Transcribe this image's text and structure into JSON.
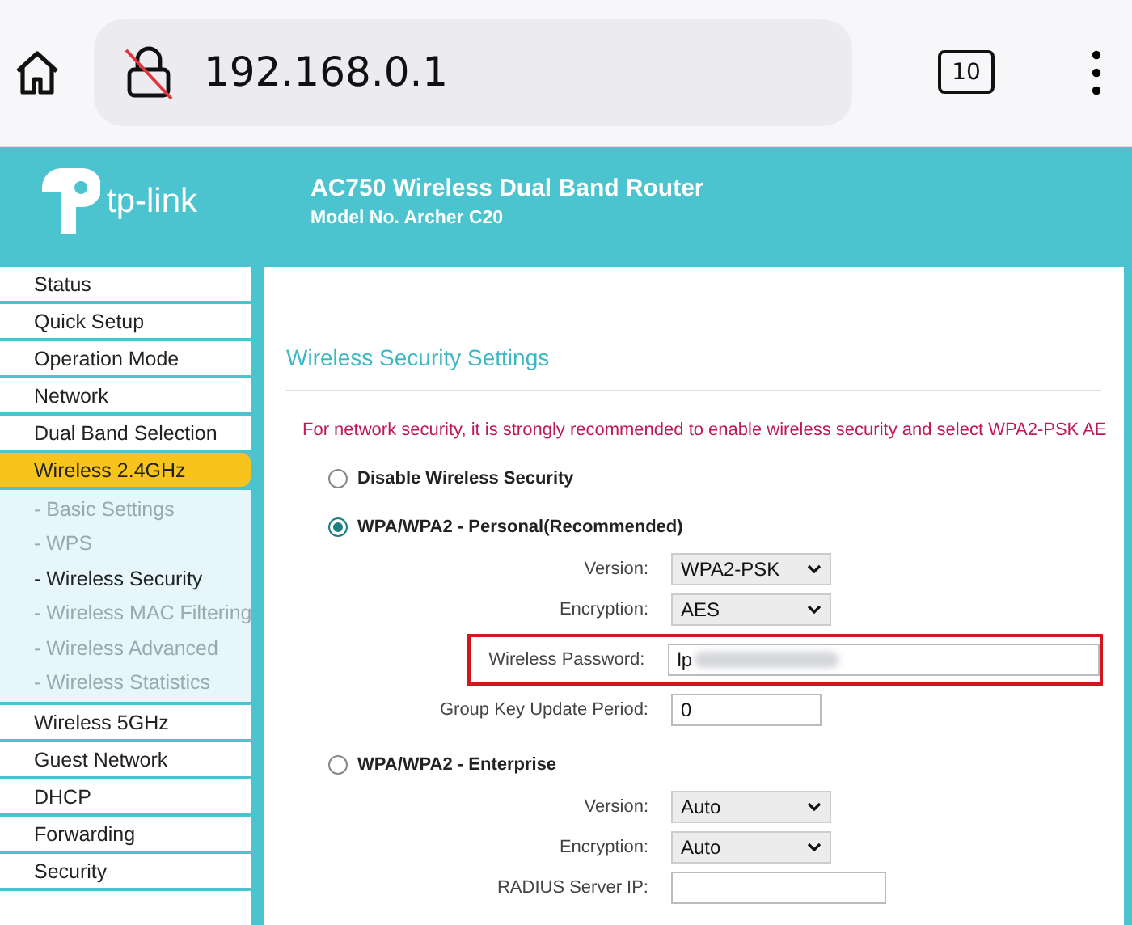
{
  "browser": {
    "url": "192.168.0.1",
    "tab_count": "10"
  },
  "header": {
    "title": "AC750 Wireless Dual Band Router",
    "subtitle": "Model No. Archer C20",
    "logo_text": "tp-link"
  },
  "sidebar": {
    "items": [
      {
        "label": "Status",
        "selected": false
      },
      {
        "label": "Quick Setup",
        "selected": false
      },
      {
        "label": "Operation Mode",
        "selected": false
      },
      {
        "label": "Network",
        "selected": false
      },
      {
        "label": "Dual Band Selection",
        "selected": false
      },
      {
        "label": "Wireless 2.4GHz",
        "selected": true,
        "children": [
          {
            "label": "- Basic Settings",
            "selected": false
          },
          {
            "label": "- WPS",
            "selected": false
          },
          {
            "label": "- Wireless Security",
            "selected": true
          },
          {
            "label": "- Wireless MAC Filtering",
            "selected": false
          },
          {
            "label": "- Wireless Advanced",
            "selected": false
          },
          {
            "label": "- Wireless Statistics",
            "selected": false
          }
        ]
      },
      {
        "label": "Wireless 5GHz",
        "selected": false
      },
      {
        "label": "Guest Network",
        "selected": false
      },
      {
        "label": "DHCP",
        "selected": false
      },
      {
        "label": "Forwarding",
        "selected": false
      },
      {
        "label": "Security",
        "selected": false
      }
    ]
  },
  "main": {
    "title": "Wireless Security Settings",
    "warning": "For network security, it is strongly recommended to enable wireless security and select WPA2-PSK AE",
    "options": [
      {
        "label": "Disable Wireless Security",
        "selected": false
      },
      {
        "label": "WPA/WPA2 - Personal(Recommended)",
        "selected": true,
        "fields": [
          {
            "kind": "select",
            "label": "Version:",
            "value": "WPA2-PSK"
          },
          {
            "kind": "select",
            "label": "Encryption:",
            "value": "AES"
          },
          {
            "kind": "password",
            "label": "Wireless Password:",
            "value": "lp",
            "highlighted": true
          },
          {
            "kind": "input",
            "label": "Group Key Update Period:",
            "value": "0"
          }
        ]
      },
      {
        "label": "WPA/WPA2 - Enterprise",
        "selected": false,
        "fields": [
          {
            "kind": "select",
            "label": "Version:",
            "value": "Auto"
          },
          {
            "kind": "select",
            "label": "Encryption:",
            "value": "Auto"
          },
          {
            "kind": "input",
            "label": "RADIUS Server IP:"
          }
        ]
      }
    ]
  }
}
